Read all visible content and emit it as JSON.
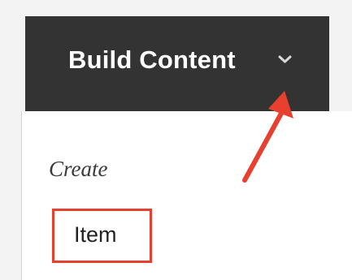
{
  "toolbar": {
    "build_content_label": "Build Content",
    "chevron_icon": "chevron-down-icon"
  },
  "menu": {
    "section_heading": "Create",
    "items": [
      {
        "label": "Item"
      }
    ]
  },
  "annotation": {
    "arrow_color": "#e8402f",
    "highlight_color": "#e8402f",
    "arrow_icon": "red-arrow-icon"
  },
  "colors": {
    "toolbar_bg": "#333333",
    "toolbar_text": "#ffffff",
    "page_bg": "#f3f3f3",
    "menu_bg": "#ffffff"
  }
}
